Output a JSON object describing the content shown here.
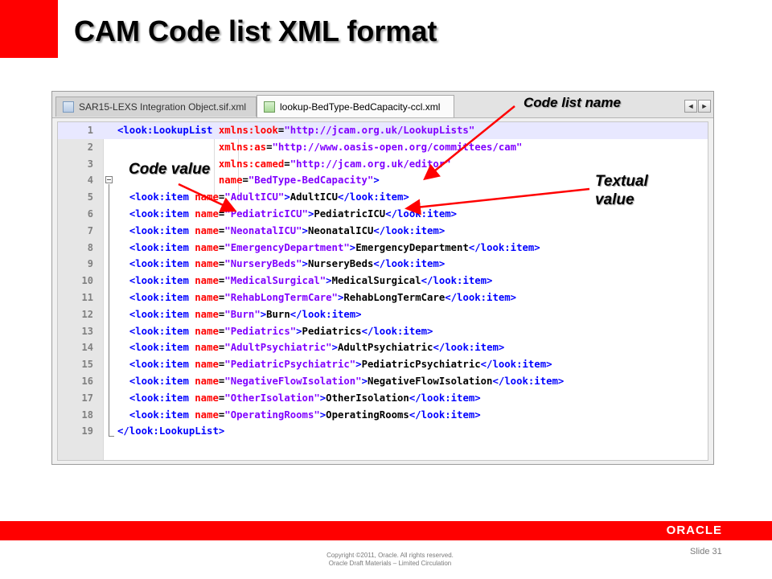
{
  "slide": {
    "title": "CAM Code list XML format",
    "slide_number": "Slide 31",
    "copyright_line1": "Copyright ©2011, Oracle. All rights reserved.",
    "copyright_line2": "Oracle Draft Materials – Limited Circulation",
    "logo_text": "ORACLE",
    "accent_color": "#ff0000"
  },
  "editor": {
    "tabs": [
      {
        "label": "SAR15-LEXS Integration Object.sif.xml",
        "active": false
      },
      {
        "label": "lookup-BedType-BedCapacity-ccl.xml",
        "active": true
      }
    ],
    "scroll_left_glyph": "◄",
    "scroll_right_glyph": "►",
    "line_numbers": [
      "1",
      "2",
      "3",
      "4",
      "5",
      "6",
      "7",
      "8",
      "9",
      "10",
      "11",
      "12",
      "13",
      "14",
      "15",
      "16",
      "17",
      "18",
      "19"
    ],
    "header_lines": [
      {
        "tag": "<look:LookupList",
        "attr": "xmlns:look",
        "value": "\"http://jcam.org.uk/LookupLists\"",
        "close": ""
      },
      {
        "tag": "",
        "attr": "xmlns:as",
        "value": "\"http://www.oasis-open.org/committees/cam\"",
        "close": ""
      },
      {
        "tag": "",
        "attr": "xmlns:camed",
        "value": "\"http://jcam.org.uk/editor\"",
        "close": ""
      },
      {
        "tag": "",
        "attr": "name",
        "value": "\"BedType-BedCapacity\"",
        "close": ">"
      }
    ],
    "items": [
      {
        "name": "\"AdultICU\"",
        "text": "AdultICU"
      },
      {
        "name": "\"PediatricICU\"",
        "text": "PediatricICU"
      },
      {
        "name": "\"NeonatalICU\"",
        "text": "NeonatalICU"
      },
      {
        "name": "\"EmergencyDepartment\"",
        "text": "EmergencyDepartment"
      },
      {
        "name": "\"NurseryBeds\"",
        "text": "NurseryBeds"
      },
      {
        "name": "\"MedicalSurgical\"",
        "text": "MedicalSurgical"
      },
      {
        "name": "\"RehabLongTermCare\"",
        "text": "RehabLongTermCare"
      },
      {
        "name": "\"Burn\"",
        "text": "Burn"
      },
      {
        "name": "\"Pediatrics\"",
        "text": "Pediatrics"
      },
      {
        "name": "\"AdultPsychiatric\"",
        "text": "AdultPsychiatric"
      },
      {
        "name": "\"PediatricPsychiatric\"",
        "text": "PediatricPsychiatric"
      },
      {
        "name": "\"NegativeFlowIsolation\"",
        "text": "NegativeFlowIsolation"
      },
      {
        "name": "\"OtherIsolation\"",
        "text": "OtherIsolation"
      },
      {
        "name": "\"OperatingRooms\"",
        "text": "OperatingRooms"
      }
    ],
    "item_open": "<look:item",
    "item_attr": "name",
    "item_close": "</look:item>",
    "closing_tag": "</look:LookupList>",
    "equals": "=",
    "gt": ">"
  },
  "callouts": {
    "code_list_name": "Code list name",
    "code_value": "Code value",
    "textual_value_line1": "Textual",
    "textual_value_line2": "value"
  },
  "colors": {
    "tag": "#0000ff",
    "attribute": "#ff0000",
    "string_value": "#8000ff",
    "arrow": "#ff0000"
  }
}
